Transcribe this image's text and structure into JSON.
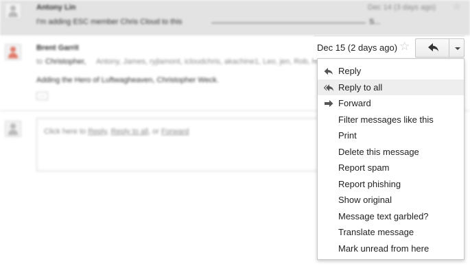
{
  "thread": {
    "msg1": {
      "sender": "Antony Lin",
      "snippet": "I'm adding ESC member Chris Cloud to this",
      "snippet_tail": "S...",
      "date": "Dec 14 (3 days ago)"
    },
    "msg2": {
      "sender": "Brent Garrit",
      "to_prefix": "to",
      "recipients_first": "Christopher,",
      "recipients_rest": "Antony, James, ryjlamont, icloudchris, akachine1, Leo, jen, Rob, Ro...",
      "body": "Adding the Hero of Luftwagheaven, Christopher Weck.",
      "dots": "···"
    },
    "reply_box": {
      "prefix": "Click here to",
      "reply": "Reply",
      "sep1": ",",
      "reply_all": "Reply to all",
      "sep2": ", or",
      "forward": "Forward"
    }
  },
  "header": {
    "date": "Dec 15 (2 days ago)",
    "star_glyph": "☆"
  },
  "menu": {
    "items": [
      {
        "label": "Reply",
        "icon": "reply-icon"
      },
      {
        "label": "Reply to all",
        "icon": "reply-all-icon",
        "highlighted": true
      },
      {
        "label": "Forward",
        "icon": "forward-icon"
      },
      {
        "label": "Filter messages like this"
      },
      {
        "label": "Print"
      },
      {
        "label": "Delete this message"
      },
      {
        "label": "Report spam"
      },
      {
        "label": "Report phishing"
      },
      {
        "label": "Show original"
      },
      {
        "label": "Message text garbled?"
      },
      {
        "label": "Translate message"
      },
      {
        "label": "Mark unread from here"
      }
    ]
  },
  "colors": {
    "menu_highlight": "#eeeeee",
    "icon_gray": "#555555",
    "avatar_red": "#e07a6a"
  }
}
